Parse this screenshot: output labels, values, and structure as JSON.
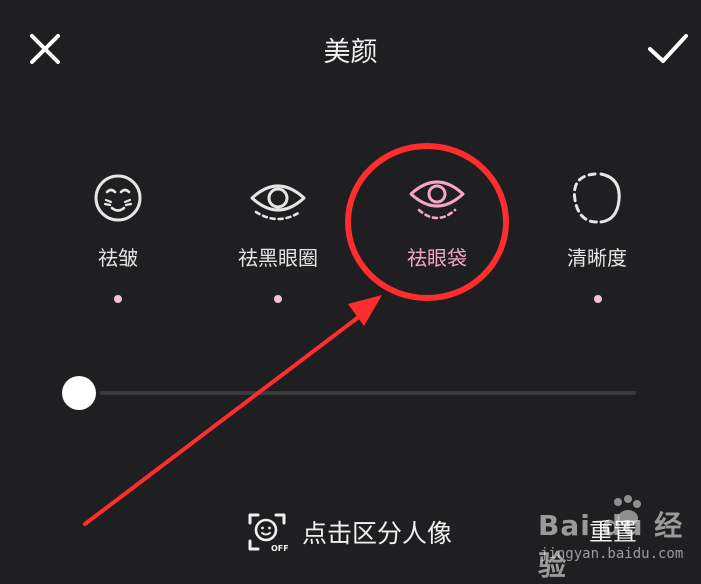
{
  "header": {
    "title": "美颜"
  },
  "tools": [
    {
      "label": "祛皱",
      "icon": "wrinkle-face-icon",
      "active": false
    },
    {
      "label": "祛黑眼圈",
      "icon": "dark-circle-eye-icon",
      "active": false
    },
    {
      "label": "祛眼袋",
      "icon": "eye-bag-icon",
      "active": true
    },
    {
      "label": "清晰度",
      "icon": "clarity-icon",
      "active": false
    }
  ],
  "slider": {
    "value": 0
  },
  "footer": {
    "segment_label": "点击区分人像",
    "segment_icon_text": "OFF",
    "reset_label": "重置"
  },
  "watermark": {
    "logo": "Bai du 经验",
    "url": "jingyan.baidu.com"
  },
  "colors": {
    "background": "#1f1f21",
    "accent": "#f4a6c6",
    "annotation": "#ff2d2d"
  }
}
